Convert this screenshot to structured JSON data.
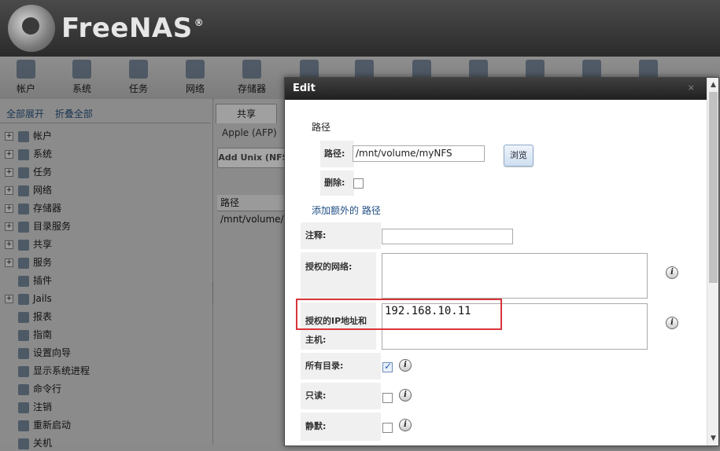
{
  "app": {
    "logo_text": "FreeNAS",
    "logo_reg": "®"
  },
  "topnav": {
    "items": [
      {
        "label": "帐户",
        "icon": "users-icon"
      },
      {
        "label": "系统",
        "icon": "system-icon"
      },
      {
        "label": "任务",
        "icon": "tasks-icon"
      },
      {
        "label": "网络",
        "icon": "network-icon"
      },
      {
        "label": "存储器",
        "icon": "storage-icon"
      },
      {
        "label": "",
        "icon": "directory-icon"
      },
      {
        "label": "",
        "icon": "sharing-icon"
      },
      {
        "label": "",
        "icon": "services-icon"
      },
      {
        "label": "",
        "icon": "plugins-icon"
      },
      {
        "label": "",
        "icon": "jails-icon"
      },
      {
        "label": "",
        "icon": "reports-icon"
      },
      {
        "label": "",
        "icon": "wizard-icon"
      }
    ]
  },
  "leftpane": {
    "expand_all": "全部展开",
    "collapse_all": "折叠全部",
    "tree": [
      {
        "label": "帐户",
        "expandable": true
      },
      {
        "label": "系统",
        "expandable": true
      },
      {
        "label": "任务",
        "expandable": true
      },
      {
        "label": "网络",
        "expandable": true
      },
      {
        "label": "存储器",
        "expandable": true
      },
      {
        "label": "目录服务",
        "expandable": true
      },
      {
        "label": "共享",
        "expandable": true
      },
      {
        "label": "服务",
        "expandable": true
      },
      {
        "label": "插件",
        "expandable": false
      },
      {
        "label": "Jails",
        "expandable": true
      },
      {
        "label": "报表",
        "expandable": false
      },
      {
        "label": "指南",
        "expandable": false
      },
      {
        "label": "设置向导",
        "expandable": false
      },
      {
        "label": "显示系统进程",
        "expandable": false
      },
      {
        "label": "命令行",
        "expandable": false
      },
      {
        "label": "注销",
        "expandable": false
      },
      {
        "label": "重新启动",
        "expandable": false
      },
      {
        "label": "关机",
        "expandable": false
      }
    ]
  },
  "content": {
    "tab_share": "共享",
    "subtab_afp": "Apple (AFP)",
    "add_button": "Add Unix (NFS",
    "grid_header": "路径",
    "grid_cell": "/mnt/volume/"
  },
  "dialog": {
    "title": "Edit",
    "close": "⨯",
    "path_section": "路径",
    "path_label": "路径:",
    "path_value": "/mnt/volume/myNFS",
    "browse": "浏览",
    "delete_label": "删除:",
    "add_path_link": "添加额外的 路径",
    "comment_label": "注释:",
    "comment_value": "",
    "networks_label": "授权的网络:",
    "hosts_label_1": "授权的IP地址和",
    "hosts_label_2": "主机:",
    "hosts_value": "192.168.10.11",
    "alldirs_label": "所有目录:",
    "alldirs_checked": true,
    "readonly_label": "只读:",
    "readonly_checked": false,
    "quiet_label": "静默:",
    "quiet_checked": false,
    "info_glyph": "i"
  }
}
